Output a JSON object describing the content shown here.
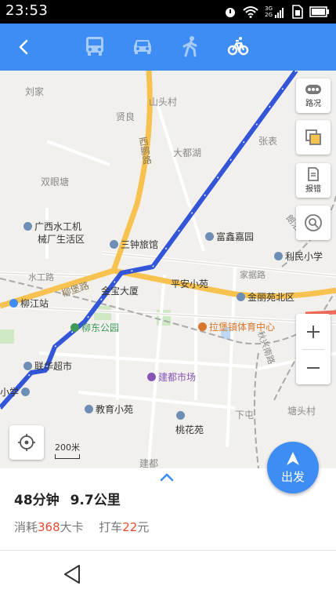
{
  "status": {
    "time": "23:53",
    "network_top": "3G",
    "network_bottom": "2G"
  },
  "navbar": {
    "modes": [
      {
        "icon": "bus-icon",
        "label": "bus"
      },
      {
        "icon": "car-icon",
        "label": "car"
      },
      {
        "icon": "walk-icon",
        "label": "walk"
      },
      {
        "icon": "bike-icon",
        "label": "bike"
      }
    ],
    "accent": "#3d8df5"
  },
  "map": {
    "labels": {
      "liujia": "刘家",
      "shantoucun": "山头村",
      "xianliang": "贤良",
      "dadouhu": "大都湖",
      "zhangdong": "张表",
      "shuangyantang": "双眼塘",
      "xiepeng_road": "西鹏路",
      "guangxi_shuigong": "广西水工机",
      "guangxi_shuigong2": "械厂生活区",
      "sanzhong_hotel": "三钟旅馆",
      "fuxin_garden": "富鑫嘉园",
      "limin_school": "利民小学",
      "shuigong_road": "水工路",
      "liubao_road": "柳堡路",
      "jiayuan_road": "家据路",
      "pingan_garden": "平安小苑",
      "jinbao_building": "金宝大厦",
      "jinli_garden": "金丽苑北区",
      "liujiang_station": "柳江站",
      "liudong_park": "柳东公园",
      "labao_sports": "拉堡镇体育中心",
      "lianhua_market": "联华超市",
      "jiandu_market": "建都市场",
      "xiaoxue": "小学",
      "jiaoyu_garden": "教育小苑",
      "taohua_garden": "桃花苑",
      "xiatun": "下屯",
      "tangtoucun": "塘头村",
      "qiuxing_road": "秋兴南路",
      "jiandu_bottom": "建都",
      "xiang": "小",
      "langxiang_road": "朗浩路"
    },
    "side_buttons": {
      "traffic": "路况",
      "report": "报错"
    },
    "scale": "200米"
  },
  "route": {
    "duration": "48分钟",
    "distance": "9.7公里",
    "calorie_prefix": "消耗",
    "calorie_value": "368",
    "calorie_unit": "大卡",
    "taxi_prefix": "打车",
    "taxi_value": "22",
    "taxi_unit": "元",
    "highlight_color": "#e9492f"
  },
  "go_button": {
    "label": "出发"
  }
}
